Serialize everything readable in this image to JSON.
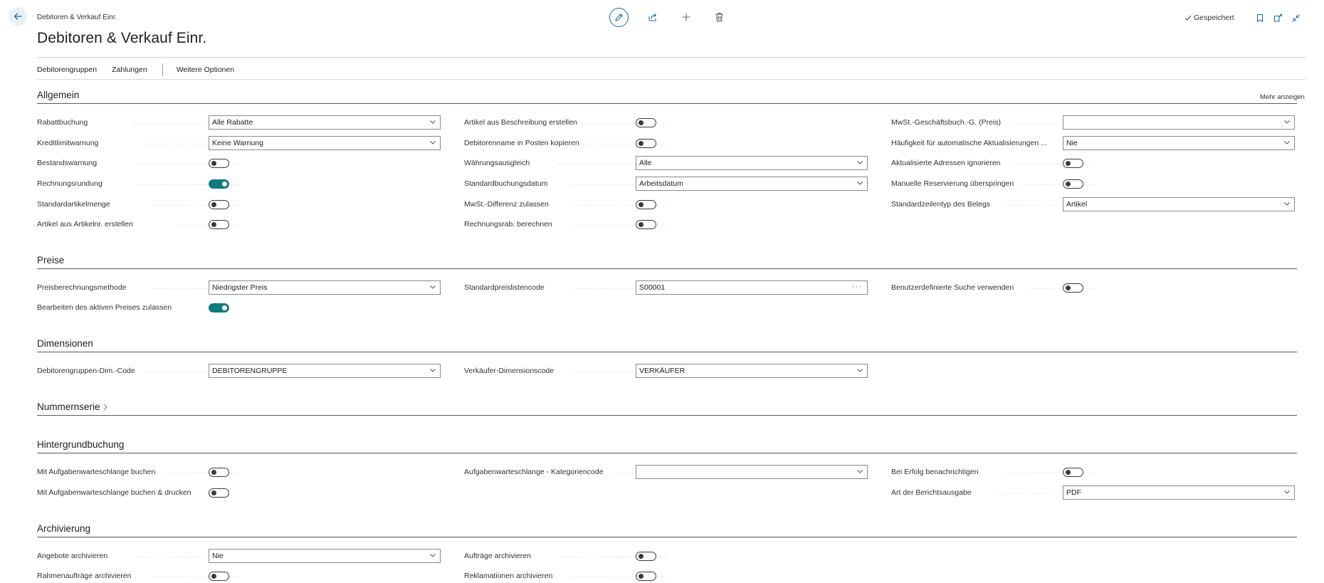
{
  "header": {
    "breadcrumb": "Debitoren & Verkauf Einr.",
    "title": "Debitoren & Verkauf Einr.",
    "saved_status": "Gespeichert"
  },
  "action_bar": {
    "customer_groups": "Debitorengruppen",
    "payments": "Zahlungen",
    "more_options": "Weitere Optionen"
  },
  "sections": {
    "general": {
      "title": "Allgemein",
      "show_more": "Mehr anzeigen",
      "discount_posting": {
        "label": "Rabattbuchung",
        "value": "Alle Rabatte"
      },
      "credit_warnings": {
        "label": "Kreditlimitwarnung",
        "value": "Keine Warnung"
      },
      "stockout_warning": {
        "label": "Bestandswarnung",
        "value": false
      },
      "invoice_rounding": {
        "label": "Rechnungsrundung",
        "value": true
      },
      "default_item_qty": {
        "label": "Standardartikelmenge",
        "value": false
      },
      "create_item_from_no": {
        "label": "Artikel aus Artikelnr. erstellen",
        "value": false
      },
      "create_item_from_desc": {
        "label": "Artikel aus Beschreibung erstellen",
        "value": false
      },
      "copy_customer_name": {
        "label": "Debitorenname in Posten kopieren",
        "value": false
      },
      "appln_between_currencies": {
        "label": "Währungsausgleich",
        "value": "Alle"
      },
      "default_posting_date": {
        "label": "Standardbuchungsdatum",
        "value": "Arbeitsdatum"
      },
      "allow_vat_difference": {
        "label": "MwSt.-Differenz zulassen",
        "value": false
      },
      "calc_inv_discount": {
        "label": "Rechnungsrab. berechnen",
        "value": false
      },
      "vat_bus_posting_gr_price": {
        "label": "MwSt.-Geschäftsbuch.-G. (Preis)",
        "value": ""
      },
      "auto_update_frequency": {
        "label": "Häufigkeit für automatische Aktualisierungen ...",
        "value": "Nie"
      },
      "ignore_updated_addresses": {
        "label": "Aktualisierte Adressen ignorieren",
        "value": false
      },
      "skip_manual_reservation": {
        "label": "Manuelle Reservierung überspringen",
        "value": false
      },
      "default_line_type": {
        "label": "Standardzeilentyp des Belegs",
        "value": "Artikel"
      }
    },
    "prices": {
      "title": "Preise",
      "price_calc_method": {
        "label": "Preisberechnungsmethode",
        "value": "Niedrigster Preis"
      },
      "allow_editing_active_price": {
        "label": "Bearbeiten des aktiven Preises zulassen",
        "value": true
      },
      "default_price_list_code": {
        "label": "Standardpreislistencode",
        "value": "S00001"
      },
      "use_customized_lookup": {
        "label": "Benutzerdefinierte Suche verwenden",
        "value": false
      }
    },
    "dimensions": {
      "title": "Dimensionen",
      "customer_group_dim_code": {
        "label": "Debitorengruppen-Dim.-Code",
        "value": "DEBITORENGRUPPE"
      },
      "salesperson_dim_code": {
        "label": "Verkäufer-Dimensionscode",
        "value": "VERKÄUFER"
      }
    },
    "number_series": {
      "title": "Nummernserie"
    },
    "background_posting": {
      "title": "Hintergrundbuchung",
      "post_with_job_queue": {
        "label": "Mit Aufgabenwarteschlange buchen",
        "value": false
      },
      "post_print_with_job_queue": {
        "label": "Mit Aufgabenwarteschlange buchen & drucken",
        "value": false
      },
      "job_queue_category_code": {
        "label": "Aufgabenwarteschlange - Kategoriencode",
        "value": ""
      },
      "notify_on_success": {
        "label": "Bei Erfolg benachrichtigen",
        "value": false
      },
      "report_output_type": {
        "label": "Art der Berichtsausgabe",
        "value": "PDF"
      }
    },
    "archiving": {
      "title": "Archivierung",
      "archive_quotes": {
        "label": "Angebote archivieren",
        "value": "Nie"
      },
      "archive_blanket_orders": {
        "label": "Rahmenaufträge archivieren",
        "value": false
      },
      "archive_orders": {
        "label": "Aufträge archivieren",
        "value": false
      },
      "archive_return_orders": {
        "label": "Reklamationen archivieren",
        "value": false
      }
    }
  },
  "colors": {
    "accent": "#0f7b80",
    "link_blue": "#1a6aa3"
  }
}
